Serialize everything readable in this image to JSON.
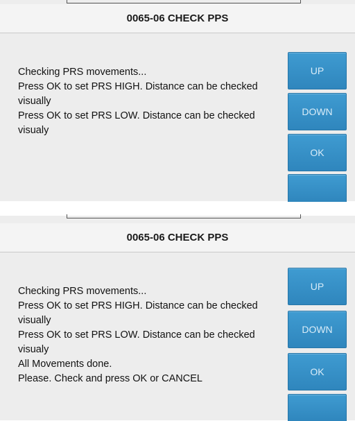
{
  "dialogs": [
    {
      "title": "0065-06 CHECK PPS",
      "message_lines": [
        "Checking PRS movements...",
        "Press OK to set PRS HIGH. Distance can be checked visually",
        "Press OK to set PRS LOW. Distance can be checked visualy"
      ],
      "buttons": {
        "up": "UP",
        "down": "DOWN",
        "ok": "OK"
      }
    },
    {
      "title": "0065-06 CHECK PPS",
      "message_lines": [
        "Checking PRS movements...",
        "Press OK to set PRS HIGH. Distance can be checked visually",
        "Press OK to set PRS LOW. Distance can be checked visualy",
        "All Movements done.",
        "Please. Check and press OK or CANCEL"
      ],
      "buttons": {
        "up": "UP",
        "down": "DOWN",
        "ok": "OK"
      }
    }
  ],
  "colors": {
    "button_blue": "#3a93cc",
    "button_text": "#d9ecf8",
    "panel_background": "#ededed"
  }
}
